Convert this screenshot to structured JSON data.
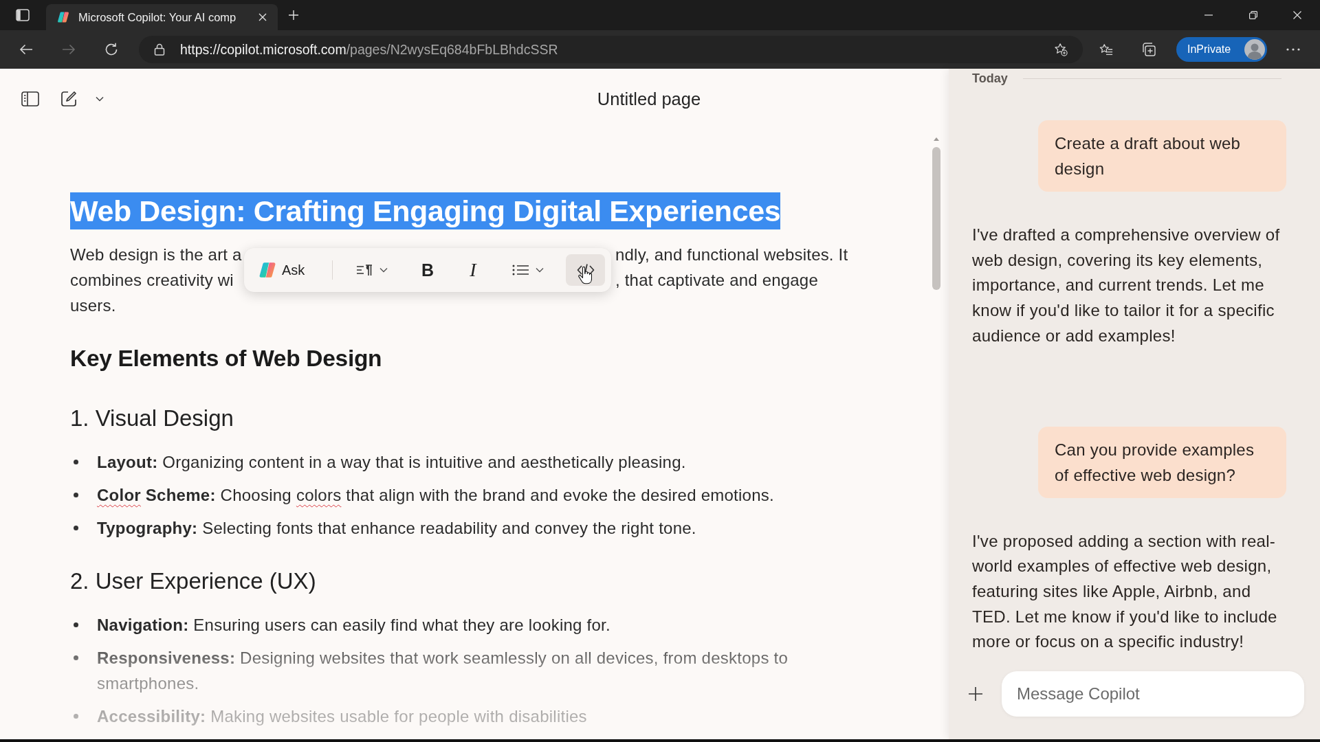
{
  "browser": {
    "tabs": [
      {
        "title": "Microsoft Copilot: Your AI comp",
        "selected": true
      }
    ],
    "nav_buttons": [
      {
        "kind": "back",
        "disabled": false
      },
      {
        "kind": "forward",
        "disabled": true
      },
      {
        "kind": "refresh",
        "disabled": false
      }
    ],
    "url": {
      "host": "https://copilot.microsoft.com",
      "path": "/pages/N2wysEq684bFbLBhdcSSR"
    },
    "profile_label": "InPrivate"
  },
  "editor": {
    "page_title": "Untitled page",
    "blocks": [
      {
        "kind": "title",
        "text": "Web Design: Crafting Engaging Digital Experiences",
        "selected": true
      },
      {
        "kind": "paragraph",
        "lines": [
          {
            "left": "Web design is the art a",
            "right": "ndly, and functional websites. It"
          },
          {
            "left": "combines creativity wi",
            "right": ", that captivate and engage"
          },
          {
            "left": "users."
          }
        ]
      },
      {
        "kind": "heading",
        "text": "Key Elements of Web Design"
      },
      {
        "kind": "subheading",
        "text": "1. Visual Design"
      },
      {
        "kind": "bullets",
        "items": [
          {
            "parts": [
              {
                "text": "Layout:",
                "bold": true,
                "misspelled": false
              },
              {
                "text": " Organizing content in a way that is intuitive and aesthetically pleasing.",
                "bold": false,
                "misspelled": false
              }
            ]
          },
          {
            "parts": [
              {
                "text": "Color",
                "bold": true,
                "misspelled": true
              },
              {
                "text": " Scheme:",
                "bold": true,
                "misspelled": false
              },
              {
                "text": " Choosing ",
                "bold": false,
                "misspelled": false
              },
              {
                "text": "colors",
                "bold": false,
                "misspelled": true
              },
              {
                "text": " that align with the brand and evoke the desired emotions.",
                "bold": false,
                "misspelled": false
              }
            ]
          },
          {
            "parts": [
              {
                "text": "Typography:",
                "bold": true,
                "misspelled": false
              },
              {
                "text": " Selecting fonts that enhance readability and convey the right tone.",
                "bold": false,
                "misspelled": false
              }
            ]
          }
        ]
      },
      {
        "kind": "subheading",
        "text": "2. User Experience (UX)"
      },
      {
        "kind": "bullets",
        "items": [
          {
            "parts": [
              {
                "text": "Navigation:",
                "bold": true,
                "misspelled": false
              },
              {
                "text": " Ensuring users can easily find what they are looking for.",
                "bold": false,
                "misspelled": false
              }
            ]
          },
          {
            "parts": [
              {
                "text": "Responsiveness:",
                "bold": true,
                "misspelled": false
              },
              {
                "text": " Designing websites that work seamlessly on all devices, from desktops to smartphones.",
                "bold": false,
                "misspelled": false
              }
            ]
          },
          {
            "parts": [
              {
                "text": "Accessibility:",
                "bold": true,
                "misspelled": false
              },
              {
                "text": " Making websites usable for people with disabilities",
                "bold": false,
                "misspelled": false
              }
            ]
          }
        ]
      }
    ],
    "selection_toolbar": {
      "items": [
        {
          "kind": "ask",
          "label": "Ask",
          "highlighted": false
        },
        {
          "kind": "paragraph_style",
          "highlighted": false
        },
        {
          "kind": "bold",
          "label": "B",
          "highlighted": false
        },
        {
          "kind": "italic",
          "label": "I",
          "highlighted": false
        },
        {
          "kind": "list",
          "highlighted": false
        },
        {
          "kind": "code",
          "highlighted": true
        }
      ]
    }
  },
  "chat": {
    "date_label": "Today",
    "messages": [
      {
        "kind": "user",
        "text": "Create a draft about web design"
      },
      {
        "kind": "assistant",
        "text": "I've drafted a comprehensive overview of web design, covering its key elements, importance, and current trends. Let me know if you'd like to tailor it for a specific audience or add examples!"
      },
      {
        "kind": "user",
        "text": "Can you provide examples of effective web design?"
      },
      {
        "kind": "assistant",
        "text": "I've proposed adding a section with real-world examples of effective web design, featuring sites like Apple, Airbnb, and TED. Let me know if you'd like to include more or focus on a specific industry!"
      }
    ],
    "input": {
      "placeholder": "Message Copilot"
    }
  }
}
